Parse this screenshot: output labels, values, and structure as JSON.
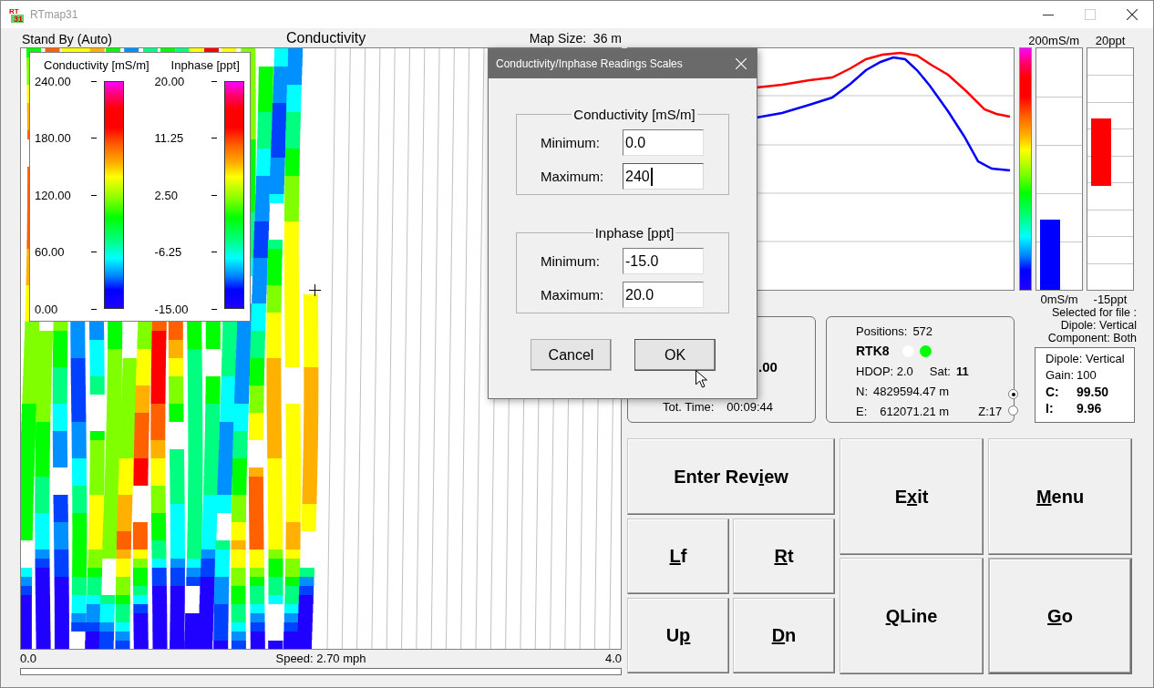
{
  "window": {
    "title": "RTmap31",
    "icon_lines": [
      "RT",
      "31"
    ]
  },
  "window_controls": [
    {
      "kind": "minimize",
      "disabled": false
    },
    {
      "kind": "maximize",
      "disabled": true
    },
    {
      "kind": "close",
      "disabled": false
    }
  ],
  "map": {
    "status": "Stand By (Auto)",
    "title": "Conductivity",
    "size_label": "Map Size:",
    "size_value": "36 m",
    "x_start": "0.0",
    "speed_label": "Speed:",
    "speed_value": "2.70 mph",
    "x_end": "4.0",
    "progress": {
      "level": 0
    }
  },
  "legend": {
    "scales": [
      {
        "title": "Conductivity [mS/m]",
        "labels": [
          "240.00",
          "180.00",
          "120.00",
          "60.00",
          "0.00"
        ]
      },
      {
        "title": "Inphase [ppt]",
        "labels": [
          "20.00",
          "11.25",
          "2.50",
          "-6.25",
          "-15.00"
        ]
      }
    ]
  },
  "meters": [
    {
      "kind": "from_bottom",
      "top_label": "200mS/m",
      "bottom_label": "0mS/m",
      "level": 0.29,
      "color": "#0000ff"
    },
    {
      "kind": "from_zero",
      "top_label": "20ppt",
      "bottom_label": "-15ppt",
      "level": 0.28,
      "color": "#ff0000"
    }
  ],
  "file_selection": {
    "heading": "Selected for file :",
    "lines": [
      "Dipole: Vertical",
      "Component: Both"
    ]
  },
  "log_panel": {
    "value": ".00",
    "time_label": "Tot. Time:",
    "time_value": "00:09:44"
  },
  "gps_panel": {
    "positions_label": "Positions:",
    "positions_value": "572",
    "fix": "RTK8",
    "indicators": [
      {
        "color": "#ffffff"
      },
      {
        "color": "#00ff00"
      }
    ],
    "hdop": "HDOP: 2.0",
    "sat_label": "Sat:",
    "sat_value": "11",
    "north_label": "N:",
    "north_value": "4829594.47 m",
    "east_label": "E:",
    "east_value": "612071.21 m",
    "zone": "Z:17"
  },
  "readings": {
    "dipole": "Dipole: Vertical",
    "gain_label": "Gain:",
    "gain_value": "100",
    "rows": [
      {
        "label": "C:",
        "value": "99.50",
        "selected": true
      },
      {
        "label": "I:",
        "value": "9.96",
        "selected": false
      }
    ]
  },
  "buttons": [
    {
      "kind": "wide",
      "default": false,
      "label_parts": [
        {
          "text": "Enter Rev",
          "underlined": false
        },
        {
          "text": "i",
          "underlined": true
        },
        {
          "text": "ew",
          "underlined": false
        }
      ]
    },
    {
      "kind": "large",
      "default": false,
      "label_parts": [
        {
          "text": "E",
          "underlined": false
        },
        {
          "text": "x",
          "underlined": true
        },
        {
          "text": "it",
          "underlined": false
        }
      ]
    },
    {
      "kind": "large",
      "default": false,
      "label_parts": [
        {
          "text": "M",
          "underlined": true
        },
        {
          "text": "enu",
          "underlined": false
        }
      ]
    },
    {
      "kind": "small",
      "default": false,
      "label_parts": [
        {
          "text": "L",
          "underlined": true
        },
        {
          "text": "f",
          "underlined": false
        }
      ]
    },
    {
      "kind": "small",
      "default": false,
      "label_parts": [
        {
          "text": "R",
          "underlined": true
        },
        {
          "text": "t",
          "underlined": false
        }
      ]
    },
    {
      "kind": "large",
      "default": false,
      "label_parts": [
        {
          "text": "Q",
          "underlined": true
        },
        {
          "text": "Line",
          "underlined": false
        }
      ]
    },
    {
      "kind": "large",
      "default": true,
      "label_parts": [
        {
          "text": "G",
          "underlined": true
        },
        {
          "text": "o",
          "underlined": false
        }
      ]
    },
    {
      "kind": "small",
      "default": false,
      "label_parts": [
        {
          "text": "U",
          "underlined": false
        },
        {
          "text": "p",
          "underlined": true
        }
      ]
    },
    {
      "kind": "small",
      "default": false,
      "label_parts": [
        {
          "text": "D",
          "underlined": true
        },
        {
          "text": "n",
          "underlined": false
        }
      ]
    }
  ],
  "dialog": {
    "title": "Conductivity/Inphase Readings Scales",
    "groups": [
      {
        "title": "Conductivity [mS/m]",
        "fields": [
          {
            "label": "Minimum:",
            "value": "0.0",
            "focused": false
          },
          {
            "label": "Maximum:",
            "value": "240",
            "focused": true
          }
        ]
      },
      {
        "title": "Inphase [ppt]",
        "fields": [
          {
            "label": "Minimum:",
            "value": "-15.0",
            "focused": false
          },
          {
            "label": "Maximum:",
            "value": "20.0",
            "focused": false
          }
        ]
      }
    ],
    "buttons": [
      {
        "label": "Cancel",
        "default": false
      },
      {
        "label": "OK",
        "default": true
      }
    ]
  }
}
